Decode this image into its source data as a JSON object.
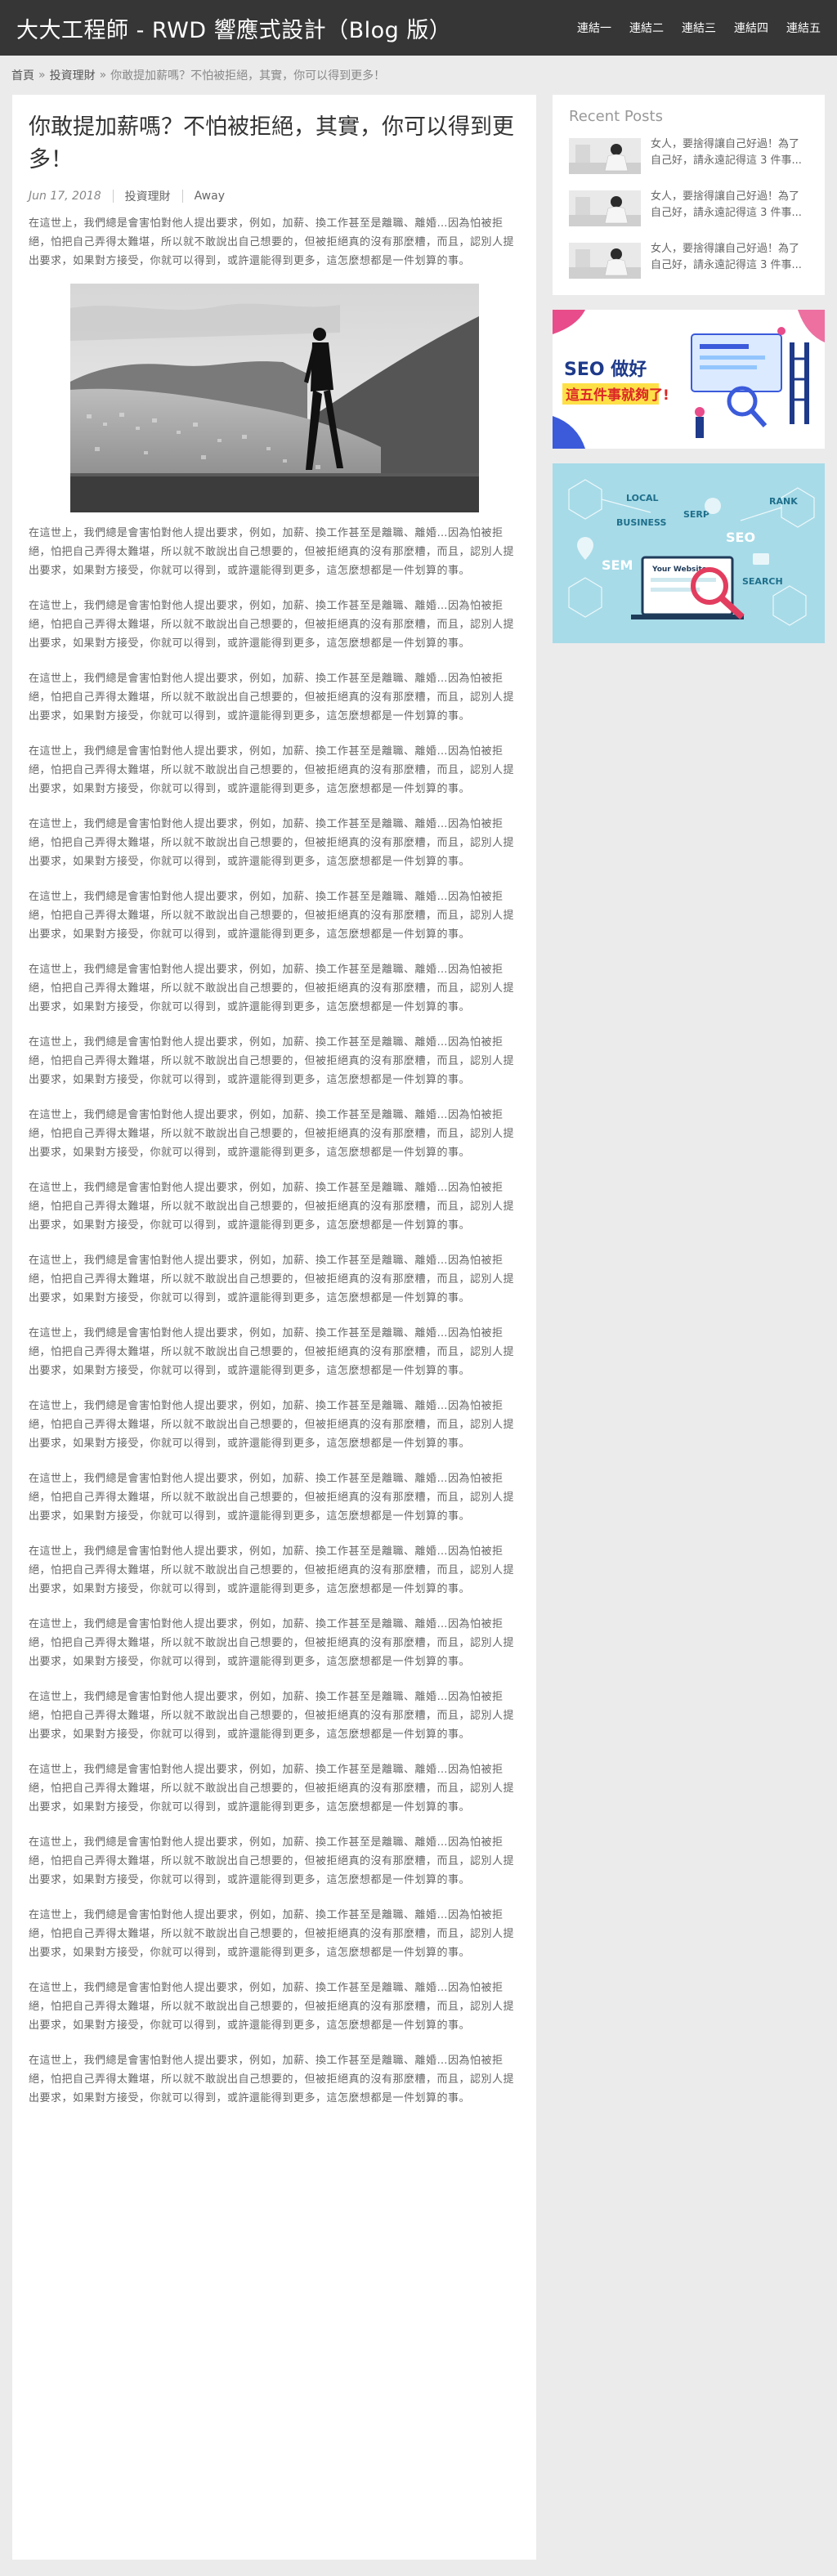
{
  "header": {
    "site_title": "大大工程師 - RWD 響應式設計（Blog 版）",
    "nav": [
      "連結一",
      "連結二",
      "連結三",
      "連結四",
      "連結五"
    ]
  },
  "breadcrumb": {
    "home": "首頁",
    "category": "投資理財",
    "current": "你敢提加薪嗎？不怕被拒絕，其實，你可以得到更多！",
    "separator": "»"
  },
  "article": {
    "title": "你敢提加薪嗎？不怕被拒絕，其實，你可以得到更多！",
    "date": "Jun 17, 2018",
    "category": "投資理財",
    "author": "Away",
    "paragraph": "在這世上，我們總是會害怕對他人提出要求，例如，加薪、換工作甚至是離職、離婚…因為怕被拒絕，怕把自己弄得太難堪，所以就不敢說出自己想要的，但被拒絕真的沒有那麼糟，而且，認別人提出要求，如果對方接受，你就可以得到，或許還能得到更多，這怎麼想都是一件划算的事。"
  },
  "sidebar": {
    "recent_title": "Recent Posts",
    "recent_posts": [
      "女人，要捨得讓自己好過！為了自己好，請永遠記得這 3 件事...",
      "女人，要捨得讓自己好過！為了自己好，請永遠記得這 3 件事...",
      "女人，要捨得讓自己好過！為了自己好，請永遠記得這 3 件事..."
    ],
    "ad1_text": "SEO 做好 這五件事就夠了!",
    "ad2_labels": [
      "LOCAL",
      "BUSINESS",
      "SERP",
      "RANK",
      "SEO",
      "SEM",
      "Your Website",
      "SEARCH"
    ]
  }
}
